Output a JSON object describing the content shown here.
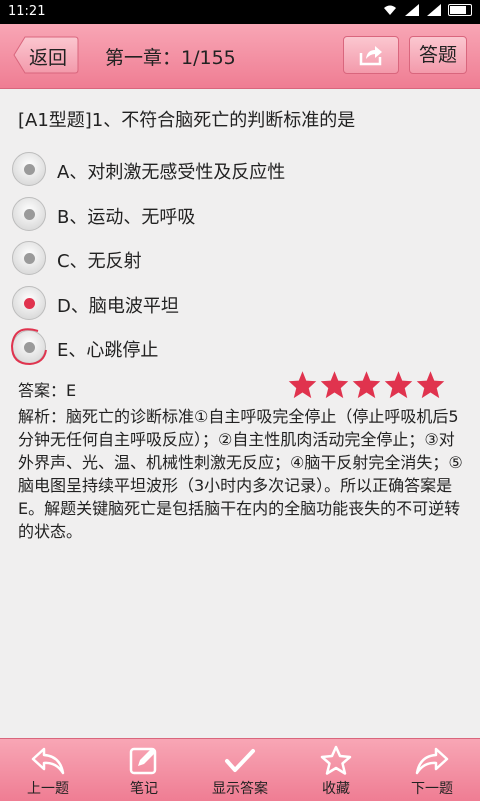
{
  "status": {
    "time": "11:21"
  },
  "header": {
    "back_label": "返回",
    "title": "第一章：1/155",
    "answer_label": "答题"
  },
  "question": {
    "text": "[A1型题]1、不符合脑死亡的判断标准的是"
  },
  "options": [
    {
      "label": "A、对刺激无感受性及反应性",
      "selected": false
    },
    {
      "label": "B、运动、无呼吸",
      "selected": false
    },
    {
      "label": "C、无反射",
      "selected": false
    },
    {
      "label": "D、脑电波平坦",
      "selected": true
    },
    {
      "label": "E、心跳停止",
      "selected": false
    }
  ],
  "answer": {
    "text": "答案：E",
    "rating": 5
  },
  "explanation": "解析：脑死亡的诊断标准①自主呼吸完全停止（停止呼吸机后5分钟无任何自主呼吸反应）；②自主性肌肉活动完全停止；③对外界声、光、温、机械性刺激无反应；④脑干反射完全消失；⑤脑电图呈持续平坦波形（3小时内多次记录）。所以正确答案是E。解题关键脑死亡是包括脑干在内的全脑功能丧失的不可逆转的状态。",
  "bottom": [
    {
      "label": "上一题",
      "icon": "reply-arrow-icon"
    },
    {
      "label": "笔记",
      "icon": "edit-note-icon"
    },
    {
      "label": "显示答案",
      "icon": "checkmark-icon"
    },
    {
      "label": "收藏",
      "icon": "star-outline-icon"
    },
    {
      "label": "下一题",
      "icon": "forward-arrow-icon"
    }
  ],
  "colors": {
    "accent": "#ef7d93",
    "star": "#e0334e",
    "selected": "#e0334e"
  }
}
